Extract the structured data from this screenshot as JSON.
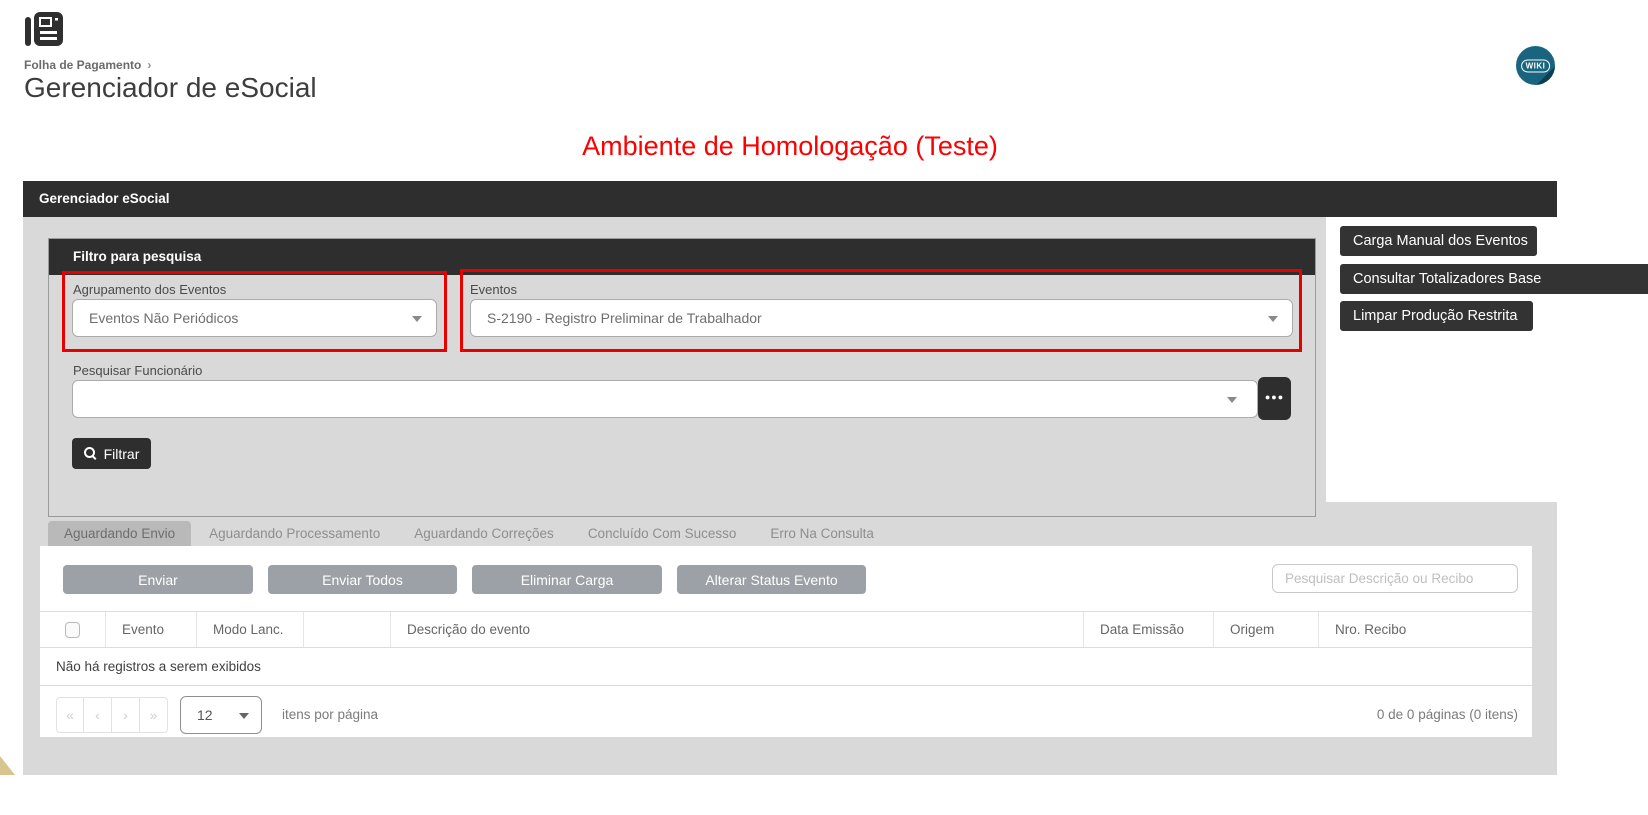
{
  "page": {
    "breadcrumb": "Folha de Pagamento",
    "breadcrumb_arrow": "›",
    "title": "Gerenciador de eSocial",
    "environment_banner": "Ambiente de Homologação (Teste)",
    "wiki_badge": "WIKI"
  },
  "window": {
    "title": "Gerenciador eSocial"
  },
  "filter": {
    "title": "Filtro para pesquisa",
    "grouping": {
      "label": "Agrupamento dos Eventos",
      "value": "Eventos Não Periódicos"
    },
    "events": {
      "label": "Eventos",
      "value": "S-2190 - Registro Preliminar de Trabalhador"
    },
    "employee": {
      "label": "Pesquisar Funcionário",
      "value": "",
      "more_button": "●●●"
    },
    "filter_button": "Filtrar"
  },
  "side_buttons": [
    {
      "label": "Carga Manual dos Eventos"
    },
    {
      "label": "Consultar Totalizadores Base"
    },
    {
      "label": "Limpar Produção Restrita"
    }
  ],
  "tabs": [
    {
      "label": "Aguardando Envio",
      "active": true
    },
    {
      "label": "Aguardando Processamento",
      "active": false
    },
    {
      "label": "Aguardando Correções",
      "active": false
    },
    {
      "label": "Concluído Com Sucesso",
      "active": false
    },
    {
      "label": "Erro Na Consulta",
      "active": false
    }
  ],
  "actions": [
    {
      "label": "Enviar"
    },
    {
      "label": "Enviar Todos"
    },
    {
      "label": "Eliminar Carga"
    },
    {
      "label": "Alterar Status Evento",
      "highlighted": true
    }
  ],
  "search": {
    "placeholder": "Pesquisar Descrição ou Recibo"
  },
  "table": {
    "columns": [
      "",
      "Evento",
      "Modo Lanc.",
      "",
      "Descrição do evento",
      "Data Emissão",
      "Origem",
      "Nro. Recibo"
    ],
    "empty_message": "Não há registros a serem exibidos"
  },
  "pagination": {
    "nav": [
      "«",
      "‹",
      "›",
      "»"
    ],
    "page_size": "12",
    "items_label": "itens por página",
    "summary": "0 de 0 páginas (0 itens)"
  },
  "colors": {
    "dark_bar": "#2e2e2e",
    "panel_gray": "#d9d9d9",
    "annotation_red": "#e60000",
    "banner_red": "#fd0000",
    "action_gray": "#9ba1a6",
    "wiki_teal": "#19657f"
  }
}
